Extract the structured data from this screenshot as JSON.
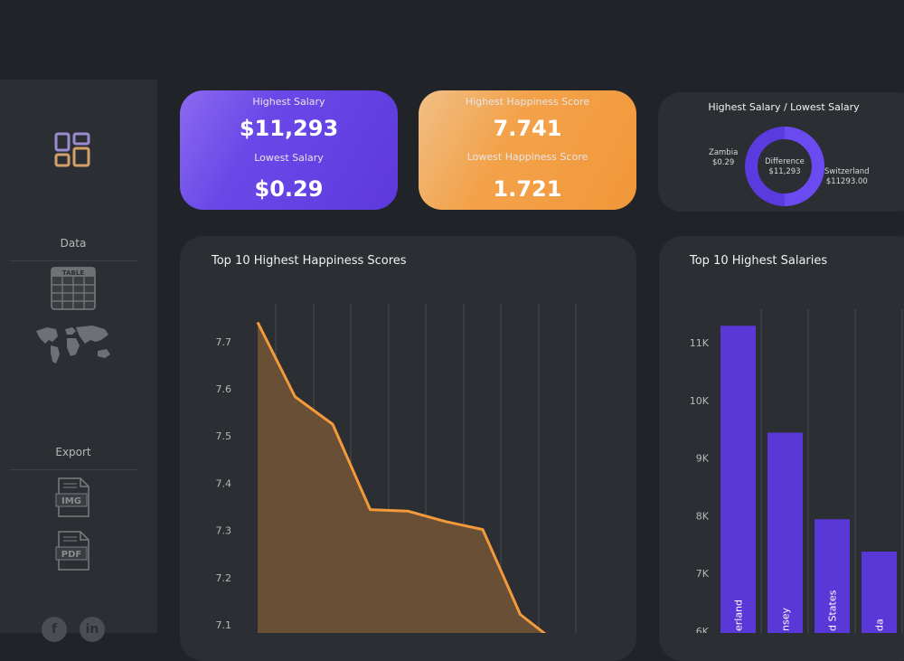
{
  "sidebar": {
    "data_label": "Data",
    "export_label": "Export",
    "table_icon_text": "TABLE",
    "img_icon_text": "IMG",
    "pdf_icon_text": "PDF",
    "social_1": "f",
    "social_2": "in"
  },
  "kpi_salary": {
    "highest_title": "Highest Salary",
    "highest_value": "$11,293",
    "lowest_title": "Lowest Salary",
    "lowest_value": "$0.29"
  },
  "kpi_happiness": {
    "highest_title": "Highest Happiness Score",
    "highest_value": "7.741",
    "lowest_title": "Lowest Happiness Score",
    "lowest_value": "1.721"
  },
  "donut": {
    "title": "Highest Salary / Lowest Salary",
    "left_country": "Zambia",
    "left_value": "$0.29",
    "right_country": "Switzerland",
    "right_value": "$11293.00",
    "center_label": "Difference",
    "center_value": "$11,293",
    "color_track": "#5a3be0",
    "color_fill": "#6c4af2"
  },
  "chart_data": [
    {
      "type": "area",
      "title": "Top 10 Highest Happiness Scores",
      "y": [
        7.741,
        7.583,
        7.525,
        7.344,
        7.341,
        7.319,
        7.302,
        7.122,
        7.06
      ],
      "ylim": [
        7.06,
        7.81
      ],
      "yticks": [
        7.1,
        7.2,
        7.3,
        7.4,
        7.5,
        7.6,
        7.7
      ],
      "xlabel": "",
      "ylabel": "",
      "grid": true,
      "colors": {
        "line": "#f39a3a",
        "fill": "#6a4f37"
      }
    },
    {
      "type": "bar",
      "title": "Top 10 Highest Salaries",
      "categories": [
        "Switzerland",
        "Guernsey",
        "United States",
        "Canada"
      ],
      "category_labels_visible": [
        "erland",
        "nsey",
        "d States",
        "da"
      ],
      "values": [
        11293,
        9440,
        7940,
        7380
      ],
      "ylim": [
        6000,
        11600
      ],
      "yticks": [
        "6K",
        "7K",
        "8K",
        "9K",
        "10K",
        "11K"
      ],
      "ytick_values": [
        6000,
        7000,
        8000,
        9000,
        10000,
        11000
      ],
      "grid": true,
      "colors": {
        "bar": "#5a38d8"
      }
    }
  ]
}
